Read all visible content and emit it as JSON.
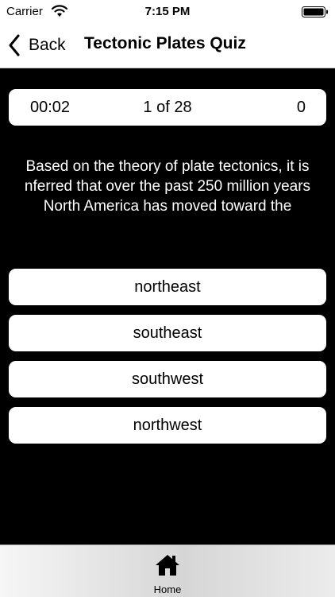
{
  "status_bar": {
    "carrier": "Carrier",
    "time": "7:15 PM"
  },
  "nav": {
    "back_label": "Back",
    "title": "Tectonic Plates Quiz"
  },
  "stats": {
    "timer": "00:02",
    "progress": "1 of 28",
    "score": "0"
  },
  "question": "Based on the theory of plate tectonics, it is nferred that over the past 250 million years North America has moved toward the",
  "answers": [
    "northeast",
    "southeast",
    "southwest",
    "northwest"
  ],
  "tab_bar": {
    "home_label": "Home"
  },
  "colors": {
    "background": "#000000",
    "panel": "#ffffff",
    "text_light": "#ffffff",
    "text_dark": "#000000"
  },
  "icons": [
    "wifi-icon",
    "battery-icon",
    "chevron-left-icon",
    "home-icon"
  ]
}
